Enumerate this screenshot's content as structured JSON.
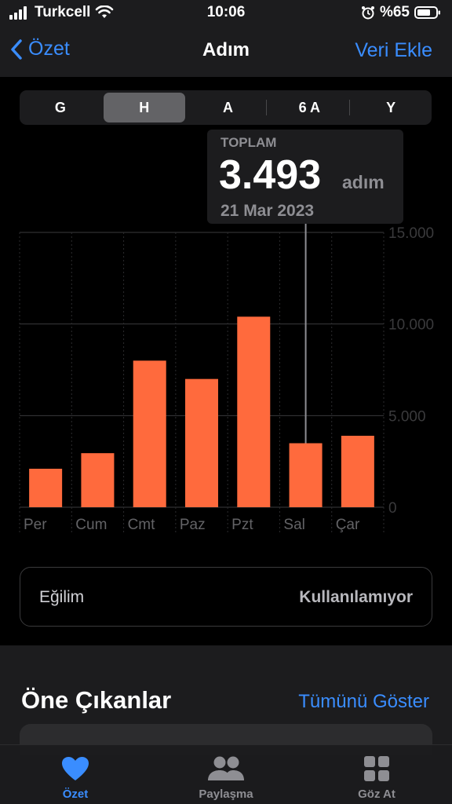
{
  "status_bar": {
    "carrier": "Turkcell",
    "time": "10:06",
    "battery": "%65"
  },
  "nav": {
    "back_label": "Özet",
    "title": "Adım",
    "action_label": "Veri Ekle"
  },
  "segments": [
    {
      "label": "G",
      "selected": false
    },
    {
      "label": "H",
      "selected": true
    },
    {
      "label": "A",
      "selected": false
    },
    {
      "label": "6 A",
      "selected": false
    },
    {
      "label": "Y",
      "selected": false
    }
  ],
  "tooltip": {
    "heading": "TOPLAM",
    "value": "3.493",
    "unit": "adım",
    "date": "21 Mar 2023"
  },
  "chart_data": {
    "type": "bar",
    "categories": [
      "Per",
      "Cum",
      "Cmt",
      "Paz",
      "Pzt",
      "Sal",
      "Çar"
    ],
    "values": [
      2100,
      2950,
      8000,
      7000,
      10400,
      3493,
      3900
    ],
    "ylim": [
      0,
      15000
    ],
    "y_ticks": [
      0,
      5000,
      10000,
      15000
    ],
    "y_tick_labels": [
      "0",
      "5.000",
      "10.000",
      "15.000"
    ],
    "selected_index": 5,
    "bar_color": "#ff6a3d",
    "grid": true,
    "xlabel": "",
    "ylabel": "",
    "title": ""
  },
  "trend": {
    "label": "Eğilim",
    "value": "Kullanılamıyor"
  },
  "highlights": {
    "title": "Öne Çıkanlar",
    "link": "Tümünü Göster"
  },
  "tabs": [
    {
      "label": "Özet",
      "icon": "heart-icon",
      "active": true
    },
    {
      "label": "Paylaşma",
      "icon": "people-icon",
      "active": false
    },
    {
      "label": "Göz At",
      "icon": "grid-icon",
      "active": false
    }
  ],
  "colors": {
    "accent": "#3a8dff",
    "bar": "#ff6a3d",
    "background": "#000000"
  }
}
